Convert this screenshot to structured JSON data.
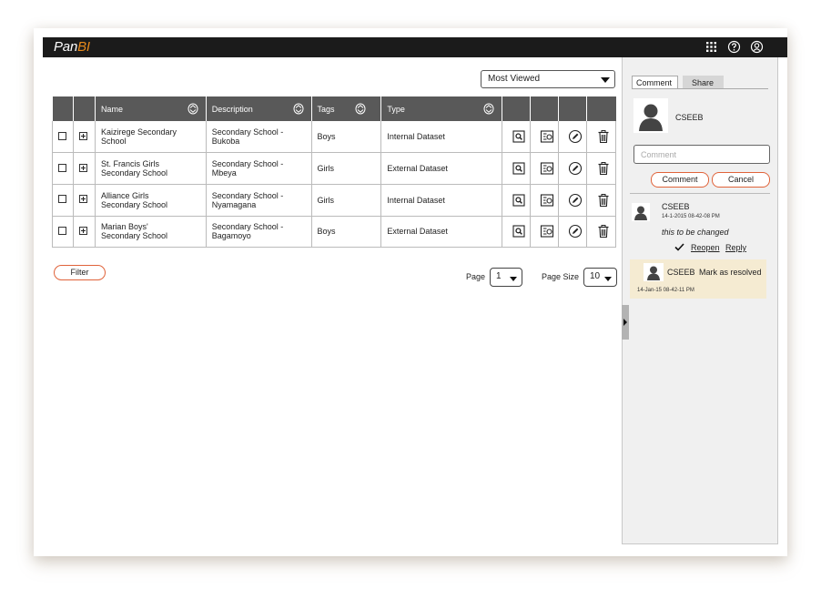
{
  "app": {
    "logo_main": "Pan",
    "logo_accent": "BI"
  },
  "topbar_icons": [
    "apps-grid-icon",
    "help-icon",
    "user-icon"
  ],
  "toolbar": {
    "sort_value": "Most Viewed"
  },
  "table": {
    "headers": [
      "Name",
      "Description",
      "Tags",
      "Type"
    ],
    "rows": [
      {
        "name": [
          "Kaizirege Secondary",
          "School"
        ],
        "description": [
          "Secondary School -",
          "Bukoba"
        ],
        "tags": "Boys",
        "type": "Internal Dataset"
      },
      {
        "name": [
          "St. Francis Girls",
          "Secondary School"
        ],
        "description": [
          "Secondary School -",
          "Mbeya"
        ],
        "tags": "Girls",
        "type": "External Dataset"
      },
      {
        "name": [
          "Alliance Girls",
          "Secondary School"
        ],
        "description": [
          "Secondary School -",
          "Nyamagana"
        ],
        "tags": "Girls",
        "type": "Internal Dataset"
      },
      {
        "name": [
          "Marian Boys'",
          "Secondary School"
        ],
        "description": [
          "Secondary School -",
          "Bagamoyo"
        ],
        "tags": "Boys",
        "type": "External Dataset"
      }
    ],
    "row_action_icons": [
      "view-icon",
      "preview-icon",
      "edit-icon",
      "delete-icon"
    ]
  },
  "footer": {
    "filter_label": "Filter",
    "page_label": "Page",
    "page_value": "1",
    "page_size_label": "Page Size",
    "page_size_value": "10"
  },
  "panel": {
    "tabs": [
      "Comment",
      "Share"
    ],
    "current_user": "CSEEB",
    "comment_placeholder": "Comment",
    "comment_button": "Comment",
    "cancel_button": "Cancel",
    "comments": [
      {
        "user": "CSEEB",
        "time": "14-1-2015 08-42-08 PM",
        "text": "this to be changed",
        "reopen": "Reopen",
        "reply": "Reply"
      }
    ],
    "resolved": {
      "user": "CSEEB",
      "label": "Mark as resolved",
      "time": "14-Jan-15  08-42-11 PM"
    }
  },
  "colors": {
    "accent": "#e8891b",
    "button_border": "#e0633a",
    "header_bg": "#595959",
    "topbar_bg": "#1b1b1b",
    "resolved_bg": "#f5ebd2"
  }
}
